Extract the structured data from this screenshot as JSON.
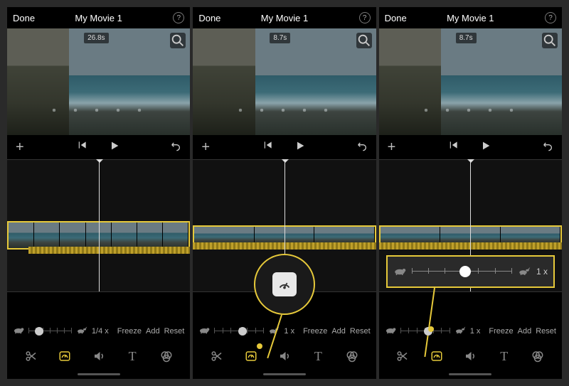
{
  "header": {
    "done": "Done",
    "title": "My Movie 1"
  },
  "p1": {
    "timestamp": "26.8s",
    "speed_label": "1/4 x",
    "slider_pos": "14%"
  },
  "p2": {
    "timestamp": "8.7s",
    "speed_label": "1 x",
    "slider_pos": "48%"
  },
  "p3": {
    "timestamp": "8.7s",
    "speed_label": "1 x",
    "slider_pos": "48%",
    "pop_speed": "1 x"
  },
  "speed": {
    "freeze": "Freeze",
    "add": "Add",
    "reset": "Reset"
  },
  "callout": {
    "icon": "speedometer-icon"
  },
  "icons": {
    "tortoise": "tortoise-icon",
    "hare": "hare-icon"
  }
}
